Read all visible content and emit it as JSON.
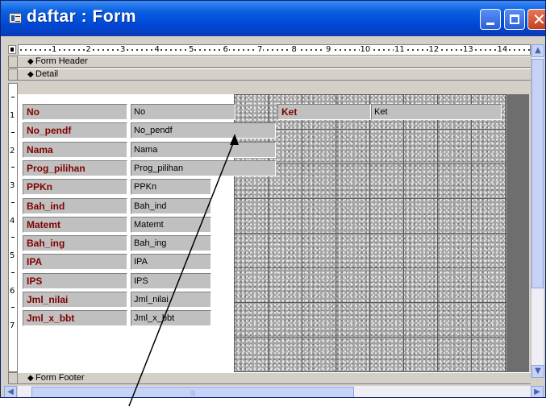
{
  "window": {
    "title": "daftar : Form",
    "close_glyph": "✕"
  },
  "ruler": {
    "numbers": [
      "1",
      "2",
      "3",
      "4",
      "5",
      "6",
      "7",
      "8",
      "9",
      "10",
      "11",
      "12",
      "13",
      "14"
    ],
    "vertical_numbers": [
      "1",
      "2",
      "3",
      "4",
      "5",
      "6",
      "7"
    ]
  },
  "sections": {
    "form_header": "Form Header",
    "detail": "Detail",
    "form_footer": "Form Footer"
  },
  "fields": [
    {
      "label": "No",
      "control": "No"
    },
    {
      "label": "No_pendf",
      "control": "No_pendf"
    },
    {
      "label": "Nama",
      "control": "Nama"
    },
    {
      "label": "Prog_pilihan",
      "control": "Prog_pilihan"
    },
    {
      "label": "PPKn",
      "control": "PPKn"
    },
    {
      "label": "Bah_ind",
      "control": "Bah_ind"
    },
    {
      "label": "Matemt",
      "control": "Matemt"
    },
    {
      "label": "Bah_ing",
      "control": "Bah_ing"
    },
    {
      "label": "IPA",
      "control": "IPA"
    },
    {
      "label": "IPS",
      "control": "IPS"
    },
    {
      "label": "Jml_nilai",
      "control": "Jml_nilai"
    },
    {
      "label": "Jml_x_bbt",
      "control": "Jml_x_bbt"
    }
  ],
  "ket": {
    "label": "Ket",
    "control": "Ket"
  },
  "icons": {
    "section_marker": "section-marker-icon",
    "scroll_up": "scroll-up-icon",
    "scroll_down": "scroll-down-icon",
    "scroll_left": "scroll-left-icon",
    "scroll_right": "scroll-right-icon"
  },
  "colors": {
    "titlebar": "#0046d5",
    "label_text": "#800000",
    "control_bg": "#c0c0c0"
  }
}
